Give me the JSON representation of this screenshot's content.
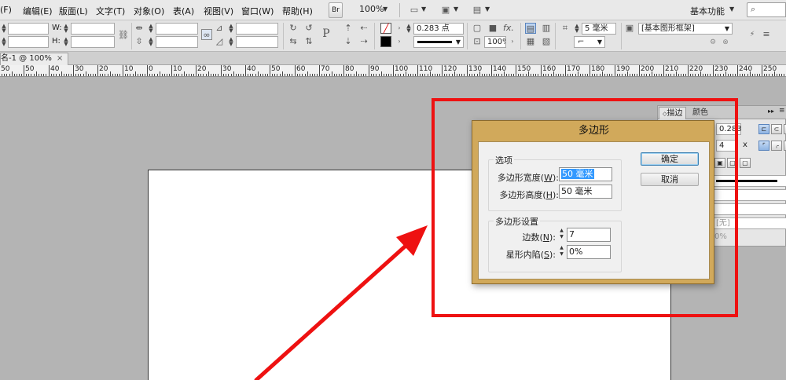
{
  "menubar": {
    "items": [
      "(F)",
      "编辑(E)",
      "版面(L)",
      "文字(T)",
      "对象(O)",
      "表(A)",
      "视图(V)",
      "窗口(W)",
      "帮助(H)"
    ],
    "bridge_label": "Br",
    "zoom": "100%",
    "workspace": "基本功能"
  },
  "controlbar": {
    "w_label": "W:",
    "h_label": "H:",
    "stroke_weight": "0.283 点",
    "percent": "100%",
    "column_value": "5 毫米",
    "object_style": "[基本图形框架]"
  },
  "document": {
    "tab_title": "名-1 @ 100%",
    "close_glyph": "×"
  },
  "ruler": {
    "labels": [
      "50",
      "50",
      "40",
      "30",
      "20",
      "10",
      "0",
      "10",
      "20",
      "30",
      "40",
      "50",
      "60",
      "70",
      "80",
      "90",
      "100",
      "110",
      "120",
      "130",
      "140",
      "150",
      "160",
      "170",
      "180",
      "190",
      "200",
      "210",
      "220",
      "230",
      "240",
      "250"
    ]
  },
  "panel": {
    "tabs": [
      "描边",
      "颜色"
    ],
    "weight": "0.283",
    "miter": "4",
    "times": "x",
    "none_label": "[无]",
    "percent": "0%"
  },
  "dialog": {
    "title": "多边形",
    "options_group": "选项",
    "width_label": "多边形宽度(",
    "width_key": "W",
    "width_value": "50 毫米",
    "height_label": "多边形高度(",
    "height_key": "H",
    "height_value": "50 毫米",
    "settings_group": "多边形设置",
    "sides_label": "边数(",
    "sides_key": "N",
    "sides_value": "7",
    "inset_label": "星形内陷(",
    "inset_key": "S",
    "inset_value": "0%",
    "close_paren": "):",
    "ok_label": "确定",
    "cancel_label": "取消"
  },
  "annotation_colors": {
    "highlight": "#ee1111",
    "dialog_frame": "#d1a95b"
  }
}
